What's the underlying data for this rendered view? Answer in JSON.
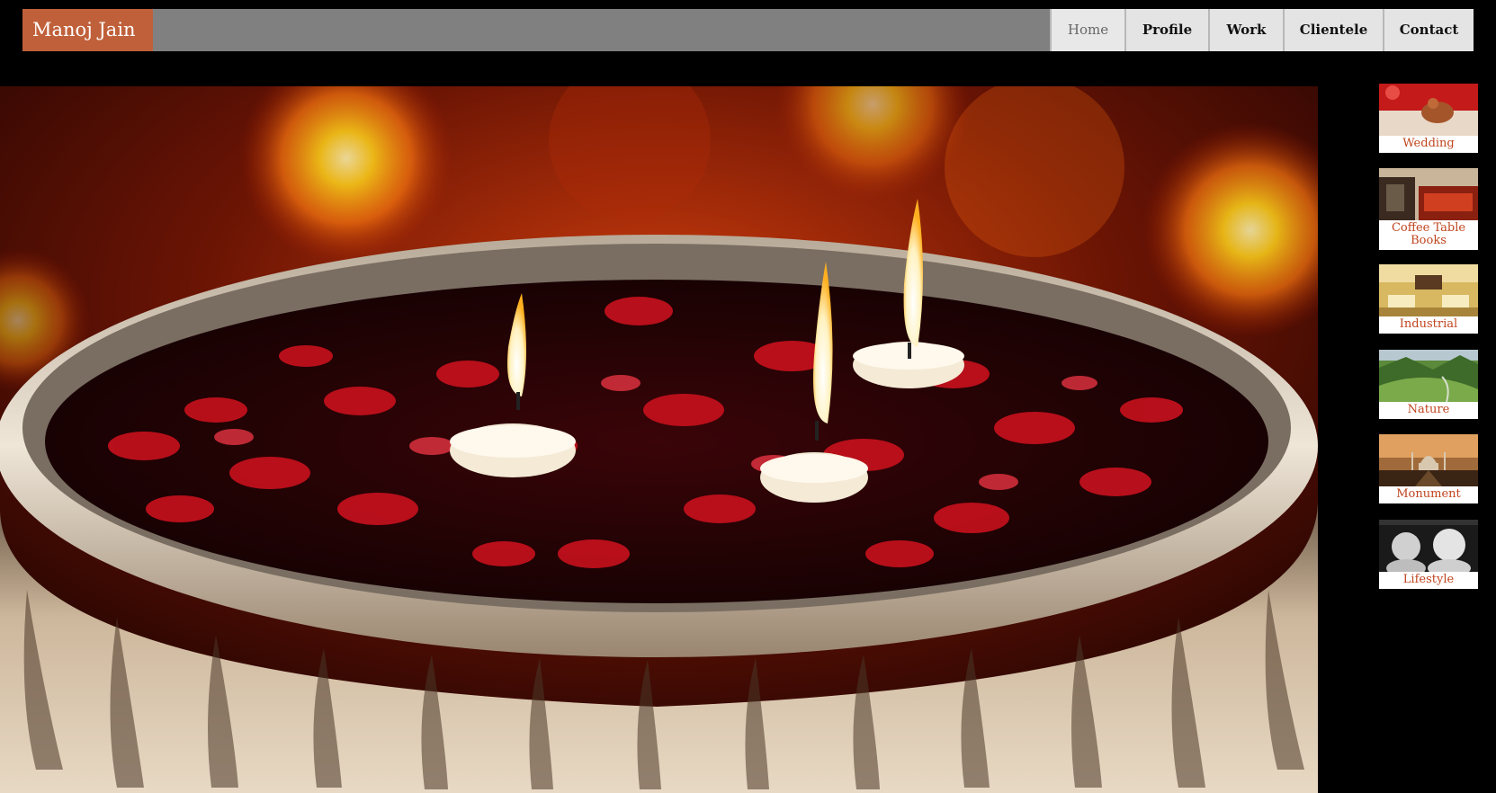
{
  "brand": {
    "name": "Manoj Jain",
    "color": "#c0603a"
  },
  "nav": {
    "items": [
      {
        "label": "Home",
        "active": true
      },
      {
        "label": "Profile",
        "active": false
      },
      {
        "label": "Work",
        "active": false
      },
      {
        "label": "Clientele",
        "active": false
      },
      {
        "label": "Contact",
        "active": false
      }
    ]
  },
  "gallery": {
    "categories": [
      {
        "label": "Wedding",
        "image": "wedding-thumbnail"
      },
      {
        "label": "Coffee Table Books",
        "image": "coffee-table-books-thumbnail"
      },
      {
        "label": "Industrial",
        "image": "industrial-thumbnail"
      },
      {
        "label": "Nature",
        "image": "nature-thumbnail"
      },
      {
        "label": "Monument",
        "image": "monument-thumbnail"
      },
      {
        "label": "Lifestyle",
        "image": "lifestyle-thumbnail"
      }
    ],
    "label_color": "#c0451e"
  },
  "hero": {
    "image": "floating-candles-in-urli-with-rose-petals"
  }
}
